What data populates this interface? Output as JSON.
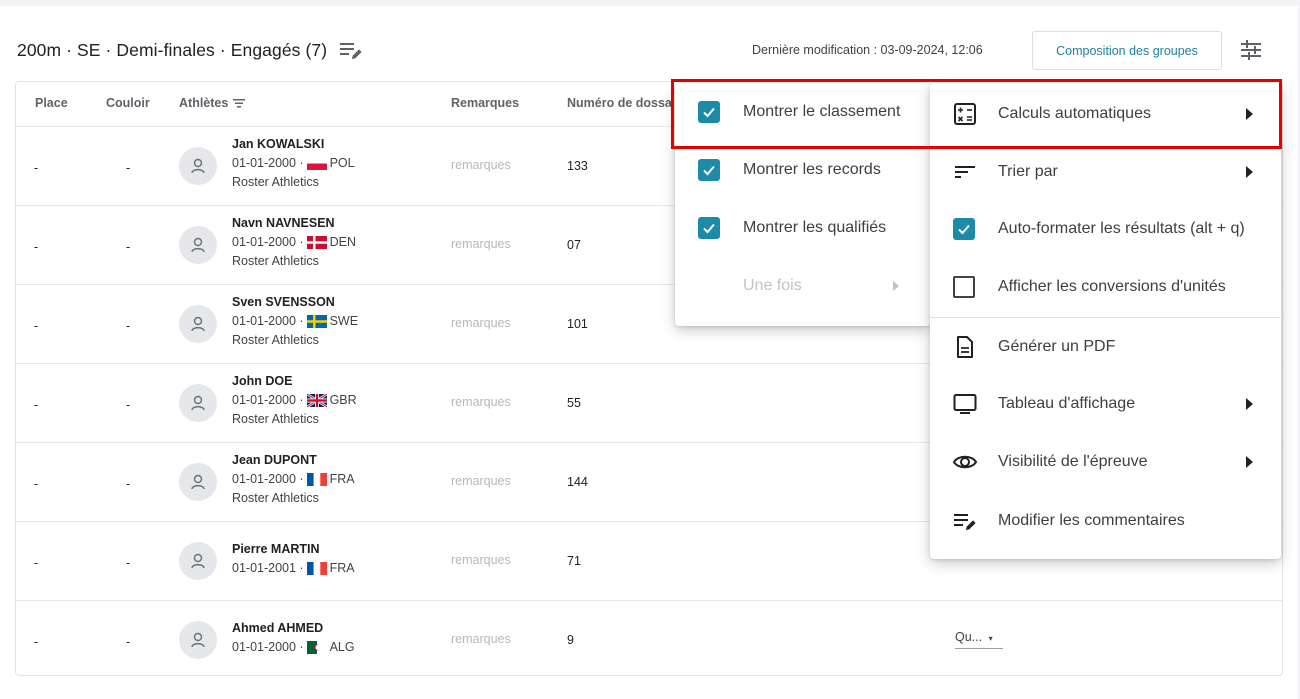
{
  "header": {
    "title": "200m · SE · Demi-finales · Engagés (7)",
    "last_modified": "Dernière modification : 03-09-2024, 12:06",
    "compose_button": "Composition des groupes"
  },
  "table": {
    "columns": {
      "place": "Place",
      "lane": "Couloir",
      "athletes": "Athlètes",
      "remarks": "Remarques",
      "bib": "Numéro de dossa"
    },
    "remark_placeholder": "remarques",
    "qual_placeholder": "Qu...",
    "rows": [
      {
        "place": "-",
        "lane": "-",
        "name": "Jan KOWALSKI",
        "dob": "01-01-2000 ·",
        "country": "POL",
        "club": "Roster Athletics",
        "bib": "133"
      },
      {
        "place": "-",
        "lane": "-",
        "name": "Navn NAVNESEN",
        "dob": "01-01-2000 ·",
        "country": "DEN",
        "club": "Roster Athletics",
        "bib": "07"
      },
      {
        "place": "-",
        "lane": "-",
        "name": "Sven SVENSSON",
        "dob": "01-01-2000 ·",
        "country": "SWE",
        "club": "Roster Athletics",
        "bib": "101"
      },
      {
        "place": "-",
        "lane": "-",
        "name": "John DOE",
        "dob": "01-01-2000 ·",
        "country": "GBR",
        "club": "Roster Athletics",
        "bib": "55"
      },
      {
        "place": "-",
        "lane": "-",
        "name": "Jean DUPONT",
        "dob": "01-01-2000 ·",
        "country": "FRA",
        "club": "Roster Athletics",
        "bib": "144"
      },
      {
        "place": "-",
        "lane": "-",
        "name": "Pierre MARTIN",
        "dob": "01-01-2001 ·",
        "country": "FRA",
        "club": "",
        "bib": "71"
      },
      {
        "place": "-",
        "lane": "-",
        "name": "Ahmed AHMED",
        "dob": "01-01-2000 ·",
        "country": "ALG",
        "club": "",
        "bib": "9"
      }
    ]
  },
  "submenu": {
    "items": [
      {
        "label": "Montrer le classement",
        "checked": true
      },
      {
        "label": "Montrer les records",
        "checked": true
      },
      {
        "label": "Montrer les qualifiés",
        "checked": true
      },
      {
        "label": "Une fois",
        "disabled": true
      }
    ]
  },
  "menu": {
    "items": [
      {
        "label": "Calculs automatiques",
        "icon": "calculator-icon"
      },
      {
        "label": "Trier par",
        "icon": "sort-icon"
      },
      {
        "label": "Auto-formater les résultats (alt + q)",
        "checked": true
      },
      {
        "label": "Afficher les conversions d'unités",
        "checked": false
      },
      {
        "label": "Générer un PDF",
        "icon": "pdf-document-icon"
      },
      {
        "label": "Tableau d'affichage",
        "icon": "monitor-icon"
      },
      {
        "label": "Visibilité de l'épreuve",
        "icon": "eye-icon"
      },
      {
        "label": "Modifier les commentaires",
        "icon": "edit-comments-icon"
      }
    ]
  },
  "colors": {
    "accent": "#1d8aa8",
    "link": "#1f7fa0",
    "highlight": "#e20000"
  }
}
